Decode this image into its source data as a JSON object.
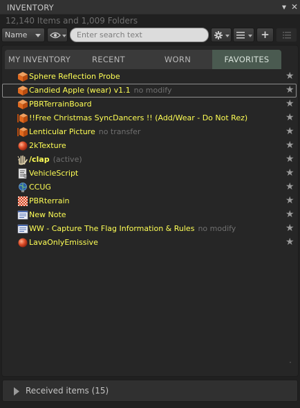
{
  "window": {
    "title": "INVENTORY",
    "minimize_glyph": "▾",
    "close_glyph": "✕"
  },
  "summary": "12,140 Items and 1,009 Folders",
  "toolbar": {
    "sort_value": "Name",
    "search_placeholder": "Enter search text",
    "eye_icon": "eye-icon",
    "gear_icon": "gear-icon",
    "view_icon": "list-view-icon",
    "add_label": "+",
    "add_icon": "plus-icon"
  },
  "tabs": [
    {
      "label": "MY INVENTORY",
      "active": false
    },
    {
      "label": "RECENT",
      "active": false
    },
    {
      "label": "WORN",
      "active": false
    },
    {
      "label": "FAVORITES",
      "active": true
    }
  ],
  "items": [
    {
      "name": "Sphere Reflection Probe",
      "suffix": "",
      "icon": "object-icon",
      "selected": false
    },
    {
      "name": "Candied Apple (wear) v1.1",
      "suffix": "no modify",
      "icon": "object-icon",
      "selected": true
    },
    {
      "name": "PBRTerrainBoard",
      "suffix": "",
      "icon": "object-icon",
      "selected": false
    },
    {
      "name": "!!Free Christmas SyncDancers !! (Add/Wear - Do Not Rez)",
      "suffix": "",
      "icon": "object-multi-icon",
      "selected": false
    },
    {
      "name": "Lenticular Picture",
      "suffix": "no transfer",
      "icon": "object-multi-icon",
      "selected": false
    },
    {
      "name": "2kTexture",
      "suffix": "",
      "icon": "material-icon",
      "selected": false
    },
    {
      "name": "/clap",
      "suffix": "(active)",
      "icon": "gesture-icon",
      "selected": false
    },
    {
      "name": "VehicleScript",
      "suffix": "",
      "icon": "script-icon",
      "selected": false
    },
    {
      "name": "CCUG",
      "suffix": "",
      "icon": "landmark-icon",
      "selected": false
    },
    {
      "name": "PBRterrain",
      "suffix": "",
      "icon": "texture-icon",
      "selected": false
    },
    {
      "name": "New Note",
      "suffix": "",
      "icon": "notecard-icon",
      "selected": false
    },
    {
      "name": "WW - Capture The Flag Information & Rules",
      "suffix": "no modify",
      "icon": "notecard-icon",
      "selected": false
    },
    {
      "name": "LavaOnlyEmissive",
      "suffix": "",
      "icon": "material-icon",
      "selected": false
    }
  ],
  "favorite_star": "★",
  "received": {
    "label": "Received items (15)"
  },
  "colors": {
    "item_name": "#ffff55",
    "item_suffix": "#707070",
    "active_tab": "#4a5a50",
    "background": "#202020"
  }
}
